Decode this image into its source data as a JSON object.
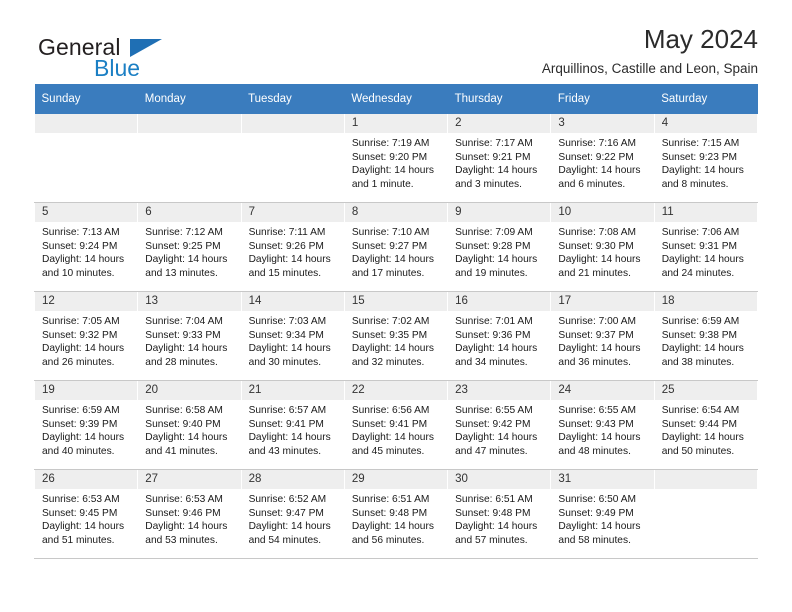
{
  "brand": {
    "word1": "General",
    "word2": "Blue",
    "triangle_color": "#1f6fb4"
  },
  "header": {
    "title": "May 2024",
    "subtitle": "Arquillinos, Castille and Leon, Spain"
  },
  "theme": {
    "header_blue": "#3a7cbe",
    "daynum_bg": "#eeeeee",
    "grid_line": "#c8c8c8"
  },
  "weekdays": [
    "Sunday",
    "Monday",
    "Tuesday",
    "Wednesday",
    "Thursday",
    "Friday",
    "Saturday"
  ],
  "weeks": [
    [
      {
        "day": "",
        "empty": true
      },
      {
        "day": "",
        "empty": true
      },
      {
        "day": "",
        "empty": true
      },
      {
        "day": "1",
        "sunrise": "Sunrise: 7:19 AM",
        "sunset": "Sunset: 9:20 PM",
        "daylight1": "Daylight: 14 hours",
        "daylight2": "and 1 minute."
      },
      {
        "day": "2",
        "sunrise": "Sunrise: 7:17 AM",
        "sunset": "Sunset: 9:21 PM",
        "daylight1": "Daylight: 14 hours",
        "daylight2": "and 3 minutes."
      },
      {
        "day": "3",
        "sunrise": "Sunrise: 7:16 AM",
        "sunset": "Sunset: 9:22 PM",
        "daylight1": "Daylight: 14 hours",
        "daylight2": "and 6 minutes."
      },
      {
        "day": "4",
        "sunrise": "Sunrise: 7:15 AM",
        "sunset": "Sunset: 9:23 PM",
        "daylight1": "Daylight: 14 hours",
        "daylight2": "and 8 minutes."
      }
    ],
    [
      {
        "day": "5",
        "sunrise": "Sunrise: 7:13 AM",
        "sunset": "Sunset: 9:24 PM",
        "daylight1": "Daylight: 14 hours",
        "daylight2": "and 10 minutes."
      },
      {
        "day": "6",
        "sunrise": "Sunrise: 7:12 AM",
        "sunset": "Sunset: 9:25 PM",
        "daylight1": "Daylight: 14 hours",
        "daylight2": "and 13 minutes."
      },
      {
        "day": "7",
        "sunrise": "Sunrise: 7:11 AM",
        "sunset": "Sunset: 9:26 PM",
        "daylight1": "Daylight: 14 hours",
        "daylight2": "and 15 minutes."
      },
      {
        "day": "8",
        "sunrise": "Sunrise: 7:10 AM",
        "sunset": "Sunset: 9:27 PM",
        "daylight1": "Daylight: 14 hours",
        "daylight2": "and 17 minutes."
      },
      {
        "day": "9",
        "sunrise": "Sunrise: 7:09 AM",
        "sunset": "Sunset: 9:28 PM",
        "daylight1": "Daylight: 14 hours",
        "daylight2": "and 19 minutes."
      },
      {
        "day": "10",
        "sunrise": "Sunrise: 7:08 AM",
        "sunset": "Sunset: 9:30 PM",
        "daylight1": "Daylight: 14 hours",
        "daylight2": "and 21 minutes."
      },
      {
        "day": "11",
        "sunrise": "Sunrise: 7:06 AM",
        "sunset": "Sunset: 9:31 PM",
        "daylight1": "Daylight: 14 hours",
        "daylight2": "and 24 minutes."
      }
    ],
    [
      {
        "day": "12",
        "sunrise": "Sunrise: 7:05 AM",
        "sunset": "Sunset: 9:32 PM",
        "daylight1": "Daylight: 14 hours",
        "daylight2": "and 26 minutes."
      },
      {
        "day": "13",
        "sunrise": "Sunrise: 7:04 AM",
        "sunset": "Sunset: 9:33 PM",
        "daylight1": "Daylight: 14 hours",
        "daylight2": "and 28 minutes."
      },
      {
        "day": "14",
        "sunrise": "Sunrise: 7:03 AM",
        "sunset": "Sunset: 9:34 PM",
        "daylight1": "Daylight: 14 hours",
        "daylight2": "and 30 minutes."
      },
      {
        "day": "15",
        "sunrise": "Sunrise: 7:02 AM",
        "sunset": "Sunset: 9:35 PM",
        "daylight1": "Daylight: 14 hours",
        "daylight2": "and 32 minutes."
      },
      {
        "day": "16",
        "sunrise": "Sunrise: 7:01 AM",
        "sunset": "Sunset: 9:36 PM",
        "daylight1": "Daylight: 14 hours",
        "daylight2": "and 34 minutes."
      },
      {
        "day": "17",
        "sunrise": "Sunrise: 7:00 AM",
        "sunset": "Sunset: 9:37 PM",
        "daylight1": "Daylight: 14 hours",
        "daylight2": "and 36 minutes."
      },
      {
        "day": "18",
        "sunrise": "Sunrise: 6:59 AM",
        "sunset": "Sunset: 9:38 PM",
        "daylight1": "Daylight: 14 hours",
        "daylight2": "and 38 minutes."
      }
    ],
    [
      {
        "day": "19",
        "sunrise": "Sunrise: 6:59 AM",
        "sunset": "Sunset: 9:39 PM",
        "daylight1": "Daylight: 14 hours",
        "daylight2": "and 40 minutes."
      },
      {
        "day": "20",
        "sunrise": "Sunrise: 6:58 AM",
        "sunset": "Sunset: 9:40 PM",
        "daylight1": "Daylight: 14 hours",
        "daylight2": "and 41 minutes."
      },
      {
        "day": "21",
        "sunrise": "Sunrise: 6:57 AM",
        "sunset": "Sunset: 9:41 PM",
        "daylight1": "Daylight: 14 hours",
        "daylight2": "and 43 minutes."
      },
      {
        "day": "22",
        "sunrise": "Sunrise: 6:56 AM",
        "sunset": "Sunset: 9:41 PM",
        "daylight1": "Daylight: 14 hours",
        "daylight2": "and 45 minutes."
      },
      {
        "day": "23",
        "sunrise": "Sunrise: 6:55 AM",
        "sunset": "Sunset: 9:42 PM",
        "daylight1": "Daylight: 14 hours",
        "daylight2": "and 47 minutes."
      },
      {
        "day": "24",
        "sunrise": "Sunrise: 6:55 AM",
        "sunset": "Sunset: 9:43 PM",
        "daylight1": "Daylight: 14 hours",
        "daylight2": "and 48 minutes."
      },
      {
        "day": "25",
        "sunrise": "Sunrise: 6:54 AM",
        "sunset": "Sunset: 9:44 PM",
        "daylight1": "Daylight: 14 hours",
        "daylight2": "and 50 minutes."
      }
    ],
    [
      {
        "day": "26",
        "sunrise": "Sunrise: 6:53 AM",
        "sunset": "Sunset: 9:45 PM",
        "daylight1": "Daylight: 14 hours",
        "daylight2": "and 51 minutes."
      },
      {
        "day": "27",
        "sunrise": "Sunrise: 6:53 AM",
        "sunset": "Sunset: 9:46 PM",
        "daylight1": "Daylight: 14 hours",
        "daylight2": "and 53 minutes."
      },
      {
        "day": "28",
        "sunrise": "Sunrise: 6:52 AM",
        "sunset": "Sunset: 9:47 PM",
        "daylight1": "Daylight: 14 hours",
        "daylight2": "and 54 minutes."
      },
      {
        "day": "29",
        "sunrise": "Sunrise: 6:51 AM",
        "sunset": "Sunset: 9:48 PM",
        "daylight1": "Daylight: 14 hours",
        "daylight2": "and 56 minutes."
      },
      {
        "day": "30",
        "sunrise": "Sunrise: 6:51 AM",
        "sunset": "Sunset: 9:48 PM",
        "daylight1": "Daylight: 14 hours",
        "daylight2": "and 57 minutes."
      },
      {
        "day": "31",
        "sunrise": "Sunrise: 6:50 AM",
        "sunset": "Sunset: 9:49 PM",
        "daylight1": "Daylight: 14 hours",
        "daylight2": "and 58 minutes."
      },
      {
        "day": "",
        "empty": true
      }
    ]
  ]
}
